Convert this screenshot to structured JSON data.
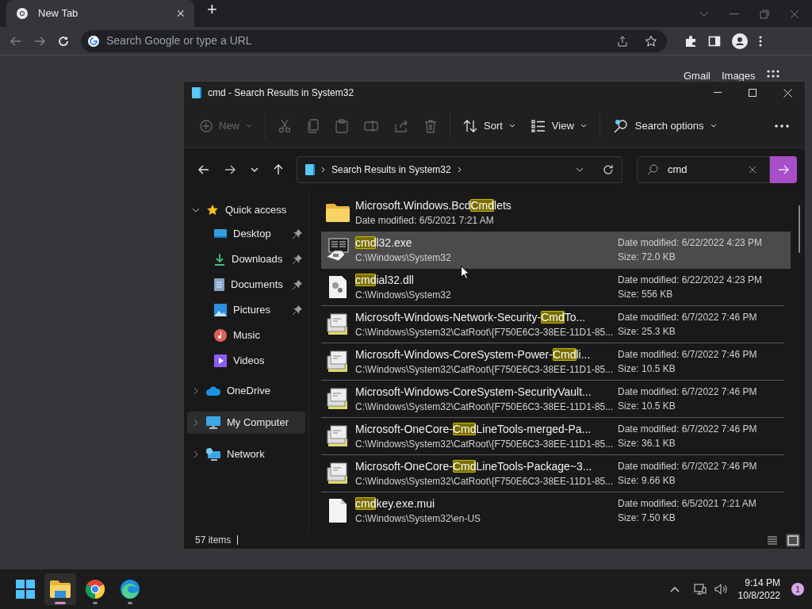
{
  "browser": {
    "tab": {
      "title": "New Tab",
      "close": "×"
    },
    "new_tab": "+",
    "omnibox": {
      "placeholder": "Search Google or type a URL"
    },
    "page_links": [
      "Gmail",
      "Images"
    ]
  },
  "explorer": {
    "title": "cmd - Search Results in System32",
    "toolbar": [
      {
        "kind": "new",
        "label": "New",
        "disabled": true
      },
      {
        "kind": "cut",
        "disabled": true
      },
      {
        "kind": "copy",
        "disabled": true
      },
      {
        "kind": "paste",
        "disabled": true
      },
      {
        "kind": "rename",
        "disabled": true
      },
      {
        "kind": "share",
        "disabled": true
      },
      {
        "kind": "delete",
        "disabled": true
      },
      {
        "kind": "sort",
        "label": "Sort",
        "disabled": false
      },
      {
        "kind": "view",
        "label": "View",
        "disabled": false
      },
      {
        "kind": "search",
        "label": "Search options",
        "disabled": false
      },
      {
        "kind": "more",
        "disabled": false
      }
    ],
    "breadcrumb": "Search Results in System32",
    "search": {
      "value": "cmd"
    },
    "nav": [
      {
        "label": "Quick access",
        "kind": "star",
        "expanded": true,
        "selected": false,
        "children": [
          {
            "label": "Desktop",
            "kind": "desktop",
            "pinned": true,
            "selected": false
          },
          {
            "label": "Downloads",
            "kind": "downloads",
            "pinned": true,
            "selected": false
          },
          {
            "label": "Documents",
            "kind": "documents",
            "pinned": true,
            "selected": false
          },
          {
            "label": "Pictures",
            "kind": "pictures",
            "pinned": true,
            "selected": false
          },
          {
            "label": "Music",
            "kind": "music",
            "pinned": false,
            "selected": false
          },
          {
            "label": "Videos",
            "kind": "videos",
            "pinned": false,
            "selected": false
          }
        ]
      },
      {
        "label": "OneDrive",
        "kind": "cloud",
        "expanded": false,
        "selected": false
      },
      {
        "label": "My Computer",
        "kind": "computer",
        "expanded": false,
        "selected": true
      },
      {
        "label": "Network",
        "kind": "network",
        "expanded": false,
        "selected": false
      }
    ],
    "files": [
      {
        "kind": "folder",
        "selected": false,
        "name": [
          {
            "text": "Microsoft.Windows.Bcd",
            "highlight": false
          },
          {
            "text": "Cmd",
            "highlight": true
          },
          {
            "text": "lets",
            "highlight": false
          }
        ],
        "subtitle": "Date modified: 6/5/2021 7:21 AM"
      },
      {
        "kind": "exe",
        "selected": true,
        "name": [
          {
            "text": "cmd",
            "highlight": true
          },
          {
            "text": "l32.exe",
            "highlight": false
          }
        ],
        "subtitle": "C:\\Windows\\System32",
        "date": "Date modified: 6/22/2022 4:23 PM",
        "size": "Size: 72.0 KB"
      },
      {
        "kind": "dll",
        "selected": false,
        "name": [
          {
            "text": "cmd",
            "highlight": true
          },
          {
            "text": "ial32.dll",
            "highlight": false
          }
        ],
        "subtitle": "C:\\Windows\\System32",
        "date": "Date modified: 6/22/2022 4:23 PM",
        "size": "Size: 556 KB"
      },
      {
        "kind": "catalog",
        "selected": false,
        "name": [
          {
            "text": "Microsoft-Windows-Network-Security-",
            "highlight": false
          },
          {
            "text": "Cmd",
            "highlight": true
          },
          {
            "text": "To...",
            "highlight": false
          }
        ],
        "subtitle": "C:\\Windows\\System32\\CatRoot\\{F750E6C3-38EE-11D1-85...",
        "date": "Date modified: 6/7/2022 7:46 PM",
        "size": "Size: 25.3 KB"
      },
      {
        "kind": "catalog",
        "selected": false,
        "name": [
          {
            "text": "Microsoft-Windows-CoreSystem-Power-",
            "highlight": false
          },
          {
            "text": "Cmd",
            "highlight": true
          },
          {
            "text": "li...",
            "highlight": false
          }
        ],
        "subtitle": "C:\\Windows\\System32\\CatRoot\\{F750E6C3-38EE-11D1-85...",
        "date": "Date modified: 6/7/2022 7:46 PM",
        "size": "Size: 10.5 KB"
      },
      {
        "kind": "catalog",
        "selected": false,
        "name": [
          {
            "text": "Microsoft-Windows-CoreSystem-SecurityVault...",
            "highlight": false
          }
        ],
        "subtitle": "C:\\Windows\\System32\\CatRoot\\{F750E6C3-38EE-11D1-85...",
        "date": "Date modified: 6/7/2022 7:46 PM",
        "size": "Size: 10.5 KB"
      },
      {
        "kind": "catalog",
        "selected": false,
        "name": [
          {
            "text": "Microsoft-OneCore-",
            "highlight": false
          },
          {
            "text": "Cmd",
            "highlight": true
          },
          {
            "text": "LineTools-merged-Pa...",
            "highlight": false
          }
        ],
        "subtitle": "C:\\Windows\\System32\\CatRoot\\{F750E6C3-38EE-11D1-85...",
        "date": "Date modified: 6/7/2022 7:46 PM",
        "size": "Size: 36.1 KB"
      },
      {
        "kind": "catalog",
        "selected": false,
        "name": [
          {
            "text": "Microsoft-OneCore-",
            "highlight": false
          },
          {
            "text": "Cmd",
            "highlight": true
          },
          {
            "text": "LineTools-Package~3...",
            "highlight": false
          }
        ],
        "subtitle": "C:\\Windows\\System32\\CatRoot\\{F750E6C3-38EE-11D1-85...",
        "date": "Date modified: 6/7/2022 7:46 PM",
        "size": "Size: 9.66 KB"
      },
      {
        "kind": "file",
        "selected": false,
        "name": [
          {
            "text": "cmd",
            "highlight": true
          },
          {
            "text": "key.exe.mui",
            "highlight": false
          }
        ],
        "subtitle": "C:\\Windows\\System32\\en-US",
        "date": "Date modified: 6/5/2021 7:21 AM",
        "size": "Size: 7.50 KB"
      }
    ],
    "status": "57 items",
    "view_modes": [
      {
        "kind": "details",
        "selected": false
      },
      {
        "kind": "tiles",
        "selected": true
      }
    ]
  },
  "taskbar": {
    "apps": [
      {
        "kind": "start",
        "active": false,
        "running": false
      },
      {
        "kind": "explorer",
        "active": true,
        "running": true
      },
      {
        "kind": "chrome",
        "active": false,
        "running": true
      },
      {
        "kind": "edge",
        "active": false,
        "running": true
      }
    ],
    "time": "9:14 PM",
    "date": "10/8/2022",
    "notifications": "1"
  }
}
